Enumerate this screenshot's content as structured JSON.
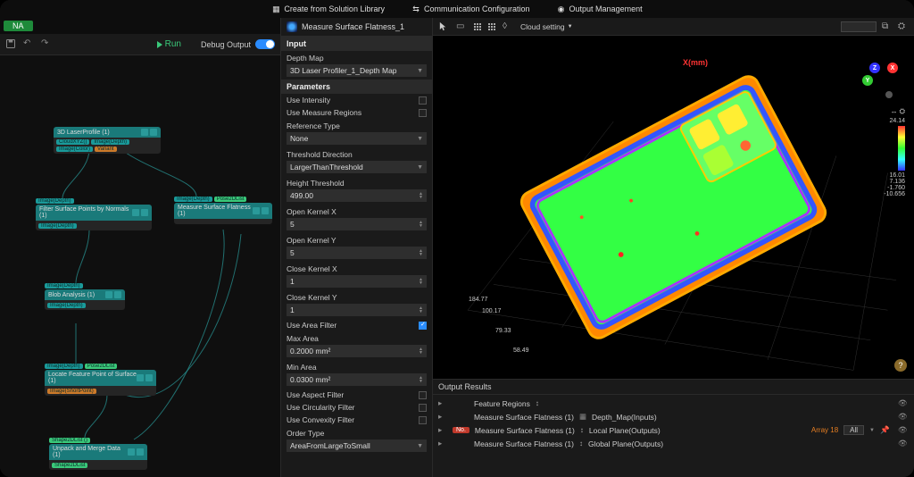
{
  "topmenu": {
    "create": "Create from Solution Library",
    "comm": "Communication Configuration",
    "output_mgmt": "Output Management"
  },
  "tab": {
    "name": "NA"
  },
  "toolbar": {
    "run": "Run",
    "debug": "Debug Output"
  },
  "graph_nodes": {
    "n1": "3D LaserProfile (1)",
    "n1_chips": [
      "CloudXYZ()",
      "Image(Depth)",
      "Image(Color)",
      "Variant"
    ],
    "n2_in": "Image(Depth)",
    "n2": "Filter Surface Points by Normals (1)",
    "n2_out": "Image(Depth)",
    "n3_in": [
      "Image(Depth)",
      "Pose2DList"
    ],
    "n3": "Measure Surface Flatness (1)",
    "n4_in": "Image(Depth)",
    "n4": "Blob Analysis (1)",
    "n4_out": "Image(Depth)",
    "n5_in": [
      "Image(Depth)",
      "Pose2DList"
    ],
    "n5": "Locate Feature Point of Surface (1)",
    "n5_out": "Image(ShortPoint)",
    "n6_in": "Shape2DList ()",
    "n6": "Unpack and Merge Data (1)",
    "n6_out": "Shape2DList"
  },
  "prop_panel": {
    "title": "Measure Surface Flatness_1",
    "section_input": "Input",
    "depth_map_label": "Depth Map",
    "depth_map_value": "3D Laser Profiler_1_Depth Map",
    "section_params": "Parameters",
    "use_intensity": "Use Intensity",
    "use_regions": "Use Measure Regions",
    "ref_type_label": "Reference Type",
    "ref_type_value": "None",
    "thresh_dir_label": "Threshold Direction",
    "thresh_dir_value": "LargerThanThreshold",
    "height_thresh_label": "Height Threshold",
    "height_thresh_value": "499.00",
    "open_kx_label": "Open Kernel X",
    "open_kx_value": "5",
    "open_ky_label": "Open Kernel Y",
    "open_ky_value": "5",
    "close_kx_label": "Close Kernel X",
    "close_kx_value": "1",
    "close_ky_label": "Close Kernel Y",
    "close_ky_value": "1",
    "use_area_filter": "Use Area Filter",
    "max_area_label": "Max Area",
    "max_area_value": "0.2000 mm²",
    "min_area_label": "Min Area",
    "min_area_value": "0.0300 mm²",
    "use_aspect": "Use Aspect Filter",
    "use_circularity": "Use Circularity Filter",
    "use_convexity": "Use Convexity Filter",
    "order_type_label": "Order Type",
    "order_type_value": "AreaFromLargeToSmall"
  },
  "viewport": {
    "cloud_setting": "Cloud setting",
    "x_label": "X(mm)",
    "legend_top": "24.14",
    "legend_v2": "16.01",
    "legend_v3": "7.136",
    "legend_v4": "-1.760",
    "legend_bot": "-10.656",
    "coords": [
      "184.77",
      "100.17",
      "79.33",
      "58.49"
    ]
  },
  "output": {
    "title": "Output Results",
    "r1": "Feature Regions",
    "r2": "Measure Surface Flatness (1)",
    "r2_field": "Depth_Map(Inputs)",
    "r3": "Measure Surface Flatness (1)",
    "r3_field": "Local Plane(Outputs)",
    "r3_badge": "No.",
    "r3_array": "Array 18",
    "r3_dd": "All",
    "r4": "Measure Surface Flatness (1)",
    "r4_field": "Global Plane(Outputs)"
  }
}
